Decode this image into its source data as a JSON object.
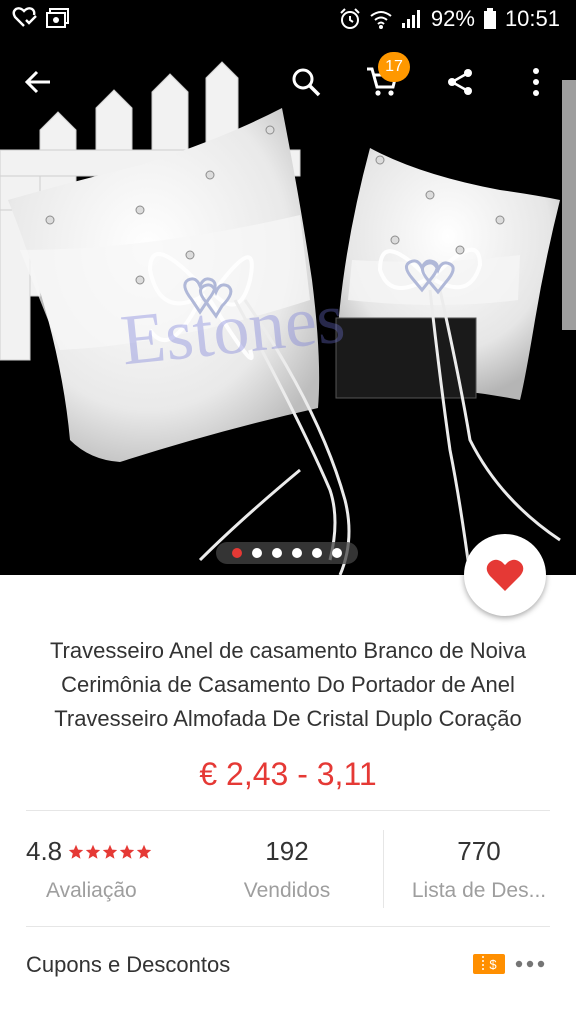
{
  "status_bar": {
    "battery": "92%",
    "time": "10:51"
  },
  "app_bar": {
    "icons": [
      "back-arrow-icon",
      "search-icon",
      "cart-icon",
      "share-icon",
      "more-vert-icon"
    ],
    "cart_count": "17"
  },
  "gallery": {
    "total_images": 6,
    "active_index": 0
  },
  "product": {
    "title_lines": [
      "Travesseiro Anel de casamento Branco de Noiva",
      "Cerimônia de Casamento Do Portador de Anel",
      "Travesseiro Almofada De Cristal Duplo Coração"
    ],
    "price": "€ 2,43 - 3,11"
  },
  "stats": {
    "rating": {
      "value": "4.8",
      "label": "Avaliação",
      "stars": 5
    },
    "sold": {
      "value": "192",
      "label": "Vendidos"
    },
    "wishlist": {
      "value": "770",
      "label": "Lista de Des..."
    }
  },
  "coupons": {
    "label": "Cupons e Descontos"
  },
  "colors": {
    "accent": "#e53935",
    "badge": "#ff9800",
    "coupon": "#ff8f00"
  }
}
